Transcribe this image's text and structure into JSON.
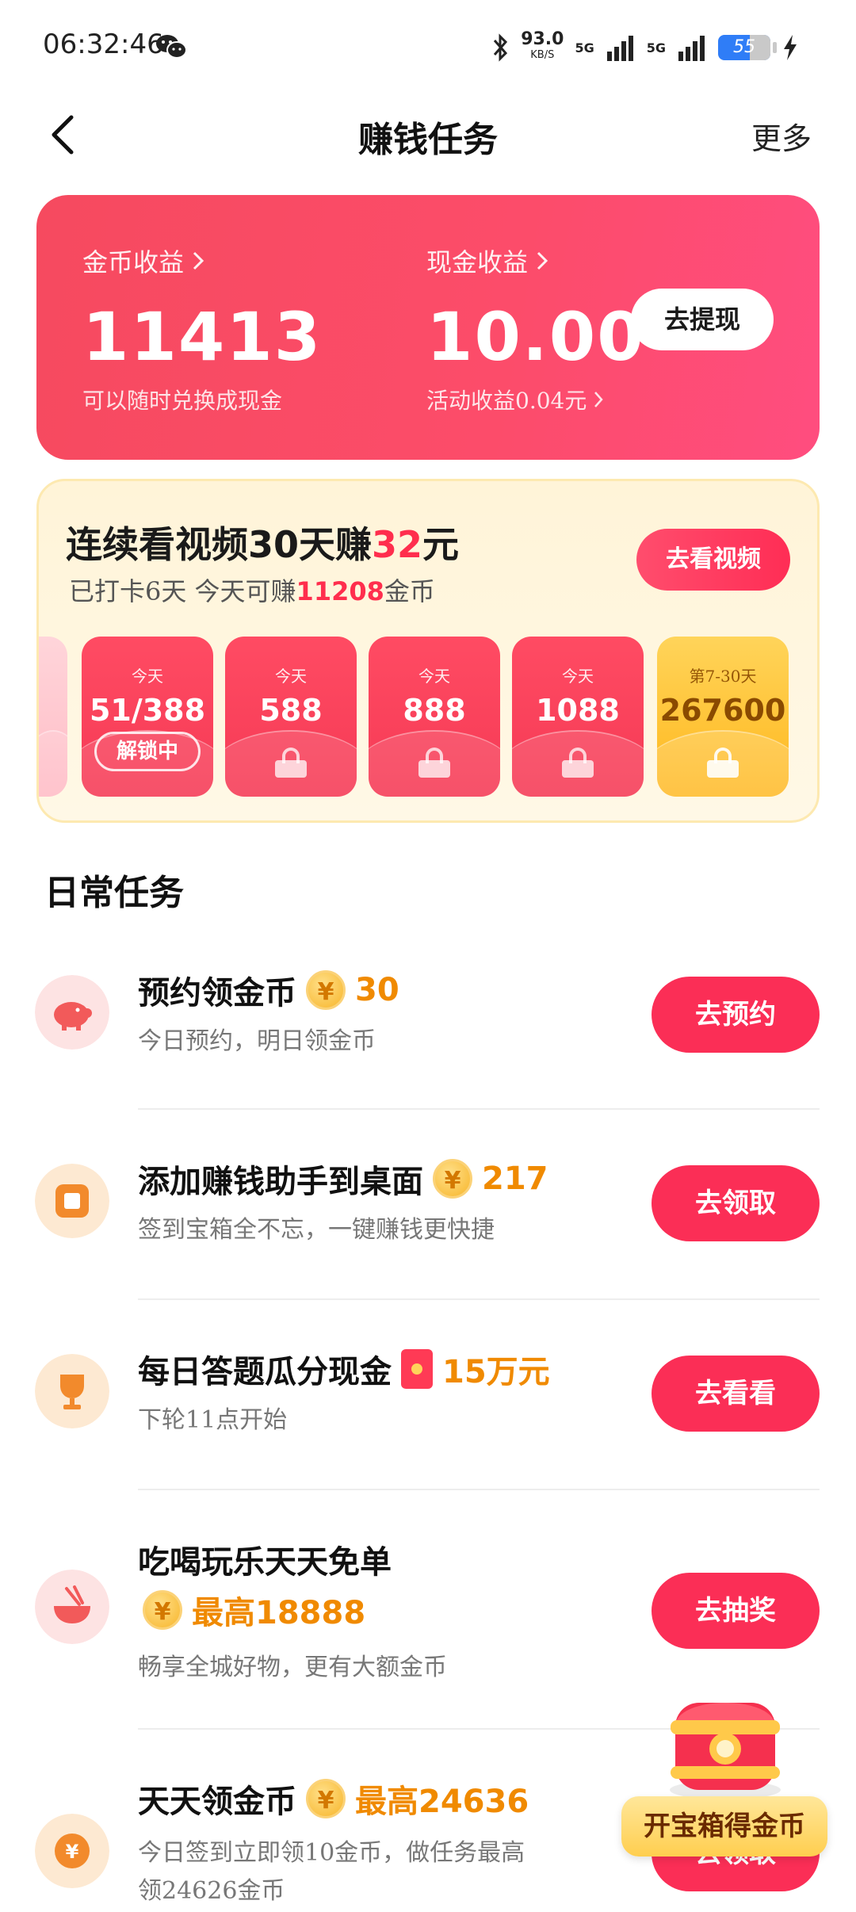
{
  "status_bar": {
    "time": "06:32:46",
    "net_speed": "93.0",
    "net_speed_unit": "KB/S",
    "net_label_1": "5G",
    "net_label_2": "5G",
    "battery": "55"
  },
  "nav": {
    "title": "赚钱任务",
    "more": "更多"
  },
  "earnings": {
    "coin_label": "金币收益",
    "coin_value": "11413",
    "coin_sub": "可以随时兑换成现金",
    "cash_label": "现金收益",
    "cash_value": "10.00",
    "cash_sub": "活动收益0.04元",
    "withdraw_button": "去提现"
  },
  "streak": {
    "title_prefix": "连续看视频30天赚",
    "title_amount": "32",
    "title_suffix": "元",
    "sub_prefix": "已打卡6天 今天可赚",
    "sub_amount": "11208",
    "sub_suffix": "金币",
    "watch_button": "去看视频",
    "rewards": [
      {
        "day": "今天",
        "amount": "51/388",
        "status": "解锁中"
      },
      {
        "day": "今天",
        "amount": "588"
      },
      {
        "day": "今天",
        "amount": "888"
      },
      {
        "day": "今天",
        "amount": "1088"
      },
      {
        "day": "第7-30天",
        "amount": "267600"
      }
    ]
  },
  "daily": {
    "section_title": "日常任务",
    "tasks": [
      {
        "title": "预约领金币",
        "reward": "30",
        "desc": "今日预约，明日领金币",
        "button": "去预约",
        "icon": "piggy-bank-icon"
      },
      {
        "title": "添加赚钱助手到桌面",
        "reward": "217",
        "desc": "签到宝箱全不忘，一键赚钱更快捷",
        "button": "去领取",
        "icon": "app-square-icon"
      },
      {
        "title": "每日答题瓜分现金",
        "reward": "15万元",
        "desc": "下轮11点开始",
        "button": "去看看",
        "icon": "trophy-icon"
      },
      {
        "title": "吃喝玩乐天天免单",
        "reward": "最高18888",
        "desc": "畅享全城好物，更有大额金币",
        "button": "去抽奖",
        "icon": "bowl-icon"
      },
      {
        "title": "天天领金币",
        "reward": "最高24636",
        "desc_line1": "今日签到立即领10金币，做任务最高",
        "desc_line2": "领24626金币",
        "button": "去领取",
        "icon": "yuan-coin-icon"
      }
    ]
  },
  "chest": {
    "label": "开宝箱得金币"
  },
  "colors": {
    "primary_red": "#fb2e56",
    "coin_orange": "#f08a00",
    "card_pink": "#fc4c6a",
    "streak_bg": "#fff4d8"
  }
}
